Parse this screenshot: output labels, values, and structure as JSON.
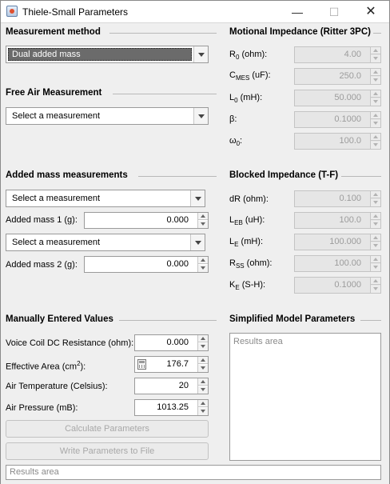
{
  "window": {
    "title": "Thiele-Small Parameters",
    "minimize": "—",
    "maximize": "☐",
    "close": "✕"
  },
  "measurement_method": {
    "title": "Measurement method",
    "selected": "Dual added mass"
  },
  "free_air": {
    "title": "Free Air Measurement",
    "selected": "Select a measurement"
  },
  "added_mass": {
    "title": "Added mass measurements",
    "measurement1": "Select a measurement",
    "mass1_label": "Added mass 1 (g):",
    "mass1_value": "0.000",
    "measurement2": "Select a measurement",
    "mass2_label": "Added mass 2 (g):",
    "mass2_value": "0.000"
  },
  "motional": {
    "title": "Motional Impedance (Ritter 3PC)",
    "r0": {
      "base": "R",
      "sub": "0",
      "suffix": " (ohm):",
      "value": "4.00"
    },
    "cmes": {
      "base": "C",
      "sub": "MES",
      "suffix": " (uF):",
      "value": "250.0"
    },
    "l0": {
      "base": "L",
      "sub": "0",
      "suffix": " (mH):",
      "value": "50.000"
    },
    "beta": {
      "base": "β",
      "sub": "",
      "suffix": ":",
      "value": "0.1000"
    },
    "omega0": {
      "base": "ω",
      "sub": "0",
      "suffix": ":",
      "value": "100.0"
    }
  },
  "blocked": {
    "title": "Blocked Impedance (T-F)",
    "dr": {
      "base": "dR",
      "sub": "",
      "suffix": " (ohm):",
      "value": "0.100"
    },
    "leb": {
      "base": "L",
      "sub": "EB",
      "suffix": " (uH):",
      "value": "100.0"
    },
    "le": {
      "base": "L",
      "sub": "E",
      "suffix": " (mH):",
      "value": "100.000"
    },
    "rss": {
      "base": "R",
      "sub": "SS",
      "suffix": " (ohm):",
      "value": "100.00"
    },
    "ke": {
      "base": "K",
      "sub": "E",
      "suffix": " (S-H):",
      "value": "0.1000"
    }
  },
  "manual": {
    "title": "Manually Entered Values",
    "voice_coil_label": "Voice Coil DC Resistance (ohm):",
    "voice_coil_value": "0.000",
    "area_label_pre": "Effective Area (cm",
    "area_label_sup": "2",
    "area_label_post": "):",
    "area_value": "176.7",
    "temp_label": "Air Temperature (Celsius):",
    "temp_value": "20",
    "pressure_label": "Air Pressure (mB):",
    "pressure_value": "1013.25"
  },
  "simplified": {
    "title": "Simplified Model Parameters",
    "results_placeholder": "Results area"
  },
  "buttons": {
    "calculate": "Calculate Parameters",
    "write": "Write Parameters to File"
  },
  "status": {
    "results_placeholder": "Results area"
  },
  "icons": {
    "app": "app-icon",
    "calculator": "calculator-icon",
    "dropdown": "chevron-down-icon"
  }
}
